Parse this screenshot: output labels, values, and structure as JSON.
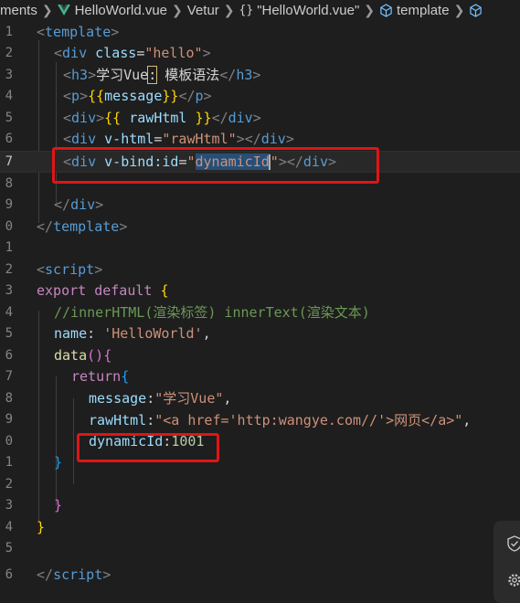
{
  "breadcrumb": {
    "items": [
      "ments",
      "HelloWorld.vue",
      "Vetur",
      "\"HelloWorld.vue\"",
      "template"
    ],
    "braces_symbol": "{}",
    "icons": [
      "vue-icon",
      "braces-icon",
      "cube-icon",
      "cube-icon"
    ]
  },
  "code": {
    "line_numbers": [
      "1",
      "2",
      "3",
      "4",
      "5",
      "6",
      "7",
      "8",
      "9",
      "0",
      "1",
      "2",
      "3",
      "4",
      "5",
      "6",
      "7",
      "8",
      "9",
      "0",
      "1",
      "2",
      "3",
      "4",
      "5",
      "6"
    ],
    "active_line_index": 6,
    "line1": {
      "open": "<",
      "tag": "template",
      "close": ">"
    },
    "line2": {
      "open": "<",
      "tag": "div",
      "attr": " class",
      "eq": "=",
      "val": "\"hello\"",
      "close": ">"
    },
    "line3": {
      "open": "<",
      "tag": "h3",
      "close": ">",
      "text_a": "学习Vue",
      "boxed": ":",
      "text_b": " 模板语法",
      "end_open": "</",
      "end_close": ">"
    },
    "line4": {
      "open": "<",
      "tag": "p",
      "close": ">",
      "mustache_open": "{{",
      "var": "message",
      "mustache_close": "}}",
      "end_open": "</",
      "end_close": ">"
    },
    "line5": {
      "open": "<",
      "tag": "div",
      "close": ">",
      "mustache_open": "{{ ",
      "var": "rawHtml",
      "mustache_close": " }}",
      "end_open": "</",
      "end_close": ">"
    },
    "line6": {
      "open": "<",
      "tag": "div",
      "attr": " v-html",
      "eq": "=",
      "val": "\"rawHtml\"",
      "close": ">",
      "end_open": "</",
      "end_close": ">"
    },
    "line7": {
      "open": "<",
      "tag": "div",
      "attr": " v-bind:id",
      "eq": "=",
      "q1": "\"",
      "selected": "dynamicId",
      "q2": "\"",
      "close": ">",
      "end_open": "</",
      "end_close": ">"
    },
    "line9": {
      "end_open": "</",
      "tag": "div",
      "end_close": ">"
    },
    "line10": {
      "end_open": "</",
      "tag": "template",
      "end_close": ">"
    },
    "line12": {
      "open": "<",
      "tag": "script",
      "close": ">"
    },
    "line13": {
      "kw1": "export",
      "kw2": " default",
      "brace": " {"
    },
    "line14": {
      "comment": "//innerHTML(渲染标签) innerText(渲染文本)"
    },
    "line15": {
      "key": "name",
      "colon": ": ",
      "val": "'HelloWorld'",
      "comma": ","
    },
    "line16": {
      "fn": "data",
      "paren": "()",
      "brace": "{"
    },
    "line17": {
      "kw": "return",
      "brace": "{"
    },
    "line18": {
      "key": "message",
      "colon": ":",
      "val": "\"学习Vue\"",
      "comma": ","
    },
    "line19": {
      "key": "rawHtml",
      "colon": ":",
      "val": "\"<a href='http:wangye.com//'>网页</a>\"",
      "comma": ","
    },
    "line20": {
      "key": "dynamicId",
      "colon": ":",
      "num": "1001"
    },
    "line21": {
      "brace": "}"
    },
    "line23": {
      "brace": "}"
    },
    "line24": {
      "brace": "}"
    },
    "line26": {
      "end_open": "</",
      "tag": "script",
      "end_close": ">"
    }
  },
  "colors": {
    "background": "#1e1e1e",
    "tag": "#569cd6",
    "attribute": "#9cdcfe",
    "string": "#ce9178",
    "keyword": "#c586c0",
    "comment": "#6a9955",
    "number": "#b5cea8",
    "highlight_box": "#e01515"
  },
  "floating_panel": {
    "icons": [
      "shield-check-icon",
      "gear-icon"
    ]
  }
}
